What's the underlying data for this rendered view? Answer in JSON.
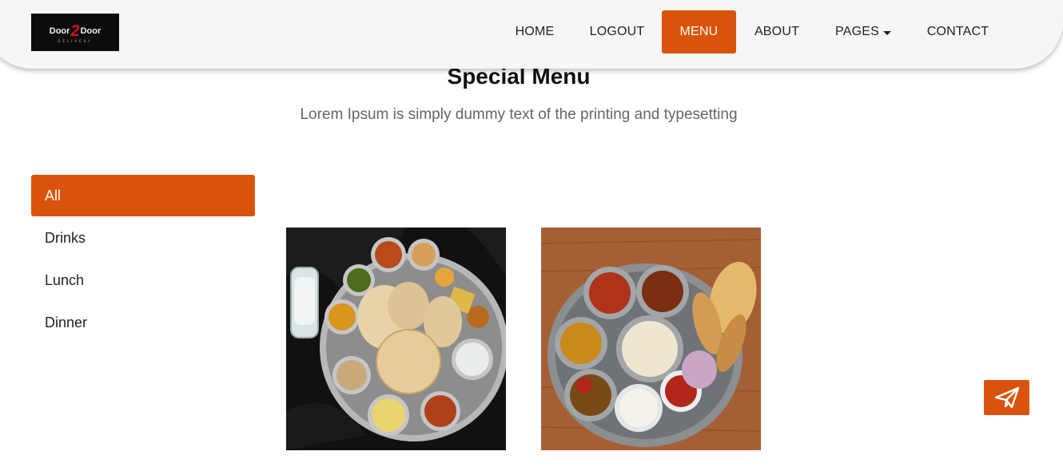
{
  "brand": {
    "logo_main_left": "Door",
    "logo_main_mid": "2",
    "logo_main_right": "Door",
    "logo_sub": "DELIVERY"
  },
  "nav": {
    "items": [
      {
        "label": "HOME"
      },
      {
        "label": "LOGOUT"
      },
      {
        "label": "MENU"
      },
      {
        "label": "ABOUT"
      },
      {
        "label": "PAGES"
      },
      {
        "label": "CONTACT"
      }
    ],
    "active": "MENU"
  },
  "section": {
    "title": "Special Menu",
    "subtitle": "Lorem Ipsum is simply dummy text of the printing and typesetting"
  },
  "filters": {
    "items": [
      {
        "label": "All"
      },
      {
        "label": "Drinks"
      },
      {
        "label": "Lunch"
      },
      {
        "label": "Dinner"
      }
    ],
    "active": "All"
  },
  "menu_cards": [
    {
      "image": "thali-plate-dark-background"
    },
    {
      "image": "thali-plate-wooden-table"
    }
  ],
  "fab": {
    "icon": "paper-plane-icon"
  },
  "colors": {
    "accent": "#d9540a",
    "navbar_bg": "#f5f6f8"
  }
}
